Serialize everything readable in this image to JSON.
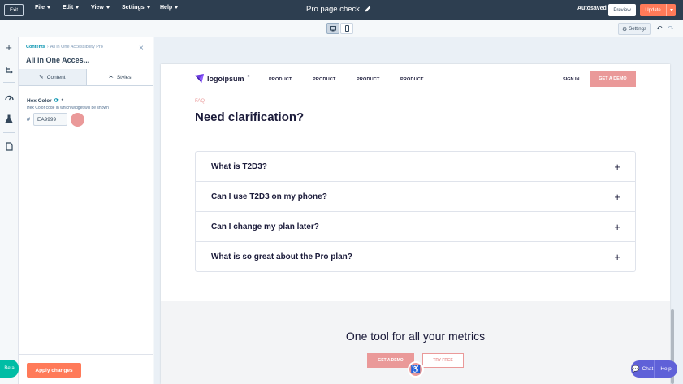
{
  "topbar": {
    "exit_label": "Exit",
    "menus": [
      "File",
      "Edit",
      "View",
      "Settings",
      "Help"
    ],
    "page_title": "Pro page check",
    "autosaved": "Autosaved",
    "preview_label": "Preview",
    "update_label": "Update"
  },
  "toolbar": {
    "settings_label": "Settings"
  },
  "rail": {
    "beta_label": "Beta"
  },
  "panel": {
    "breadcrumb_root": "Contents",
    "breadcrumb_current": "All in One Accessibility Pro",
    "title": "All in One Acces...",
    "tabs": [
      "Content",
      "Styles"
    ],
    "field_label": "Hex Color",
    "field_required": "*",
    "field_help": "Hex Color code in which widget will be shown",
    "hash": "#",
    "hex_value": "EA9999",
    "swatch_color": "#EA9999",
    "apply_label": "Apply changes"
  },
  "preview": {
    "logo_text": "logoipsum",
    "logo_mark": "®",
    "nav_links": [
      "PRODUCT",
      "PRODUCT",
      "PRODUCT",
      "PRODUCT"
    ],
    "sign_in": "SIGN IN",
    "get_demo": "GET A DEMO",
    "faq_eyebrow": "FAQ",
    "faq_heading": "Need clarification?",
    "faq_questions": [
      "What is T2D3?",
      "Can I use T2D3 on my phone?",
      "Can I change my plan later?",
      "What is so great about the Pro plan?"
    ],
    "metrics_heading": "One tool for all your metrics",
    "get_demo_2": "GET A DEMO",
    "try_free": "TRY FREE"
  },
  "chat": {
    "chat_label": "Chat",
    "help_label": "Help"
  },
  "colors": {
    "topbar": "#2d3e50",
    "accent": "#ff7a59",
    "brand_pink": "#EA9999",
    "beta": "#00bda5",
    "chat": "#5f61d8"
  }
}
